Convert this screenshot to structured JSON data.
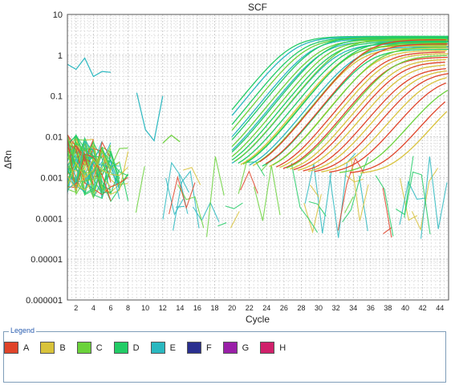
{
  "chart_data": {
    "type": "line",
    "title": "SCF",
    "xlabel": "Cycle",
    "ylabel": "ΔRn",
    "y_scale": "log",
    "xlim": [
      1,
      45
    ],
    "ylim": [
      1e-06,
      10
    ],
    "x_ticks": [
      "2",
      "4",
      "6",
      "8",
      "10",
      "12",
      "14",
      "16",
      "18",
      "20",
      "22",
      "24",
      "26",
      "28",
      "30",
      "32",
      "34",
      "36",
      "38",
      "40",
      "42",
      "44"
    ],
    "y_ticks": [
      "10",
      "1",
      "0.1",
      "0.01",
      "0.001",
      "0.0001",
      "0.00001",
      "0.000001"
    ],
    "grid": true,
    "legend": {
      "title": "Legend",
      "placement": "bottom",
      "items": [
        {
          "label": "A",
          "color": "#e0442a"
        },
        {
          "label": "B",
          "color": "#d8c23a"
        },
        {
          "label": "C",
          "color": "#6ad23a"
        },
        {
          "label": "D",
          "color": "#22cc66"
        },
        {
          "label": "E",
          "color": "#2ab8c0"
        },
        {
          "label": "F",
          "color": "#2a2f8f"
        },
        {
          "label": "G",
          "color": "#9a1fa8"
        },
        {
          "label": "H",
          "color": "#d0206a"
        }
      ]
    },
    "amplification_curves": [
      {
        "group": "D",
        "ct": 20.5,
        "plateau": 2.9
      },
      {
        "group": "E",
        "ct": 21.0,
        "plateau": 2.8
      },
      {
        "group": "D",
        "ct": 21.8,
        "plateau": 2.7
      },
      {
        "group": "C",
        "ct": 22.3,
        "plateau": 2.6
      },
      {
        "group": "E",
        "ct": 22.9,
        "plateau": 2.5
      },
      {
        "group": "D",
        "ct": 23.4,
        "plateau": 2.8
      },
      {
        "group": "C",
        "ct": 23.9,
        "plateau": 2.4
      },
      {
        "group": "E",
        "ct": 24.2,
        "plateau": 2.2
      },
      {
        "group": "D",
        "ct": 24.7,
        "plateau": 2.6
      },
      {
        "group": "C",
        "ct": 25.1,
        "plateau": 2.3
      },
      {
        "group": "D",
        "ct": 25.5,
        "plateau": 2.1
      },
      {
        "group": "E",
        "ct": 25.9,
        "plateau": 1.9
      },
      {
        "group": "C",
        "ct": 26.3,
        "plateau": 2.5
      },
      {
        "group": "D",
        "ct": 26.7,
        "plateau": 2.0
      },
      {
        "group": "B",
        "ct": 27.0,
        "plateau": 1.7
      },
      {
        "group": "C",
        "ct": 27.3,
        "plateau": 1.8
      },
      {
        "group": "D",
        "ct": 27.7,
        "plateau": 2.2
      },
      {
        "group": "E",
        "ct": 28.0,
        "plateau": 1.6
      },
      {
        "group": "B",
        "ct": 28.4,
        "plateau": 1.5
      },
      {
        "group": "C",
        "ct": 28.8,
        "plateau": 2.0
      },
      {
        "group": "A",
        "ct": 29.2,
        "plateau": 2.4
      },
      {
        "group": "D",
        "ct": 29.5,
        "plateau": 1.4
      },
      {
        "group": "A",
        "ct": 29.9,
        "plateau": 1.9
      },
      {
        "group": "B",
        "ct": 30.3,
        "plateau": 1.3
      },
      {
        "group": "C",
        "ct": 30.7,
        "plateau": 1.6
      },
      {
        "group": "A",
        "ct": 31.1,
        "plateau": 1.2
      },
      {
        "group": "B",
        "ct": 31.5,
        "plateau": 1.1
      },
      {
        "group": "A",
        "ct": 31.9,
        "plateau": 0.9
      },
      {
        "group": "C",
        "ct": 32.3,
        "plateau": 1.0
      },
      {
        "group": "B",
        "ct": 32.7,
        "plateau": 0.8
      },
      {
        "group": "A",
        "ct": 33.1,
        "plateau": 0.7
      },
      {
        "group": "B",
        "ct": 33.6,
        "plateau": 0.6
      },
      {
        "group": "A",
        "ct": 34.2,
        "plateau": 0.5
      },
      {
        "group": "B",
        "ct": 34.8,
        "plateau": 0.45
      },
      {
        "group": "A",
        "ct": 35.5,
        "plateau": 0.4
      },
      {
        "group": "B",
        "ct": 36.3,
        "plateau": 0.35
      },
      {
        "group": "A",
        "ct": 37.2,
        "plateau": 0.3
      },
      {
        "group": "C",
        "ct": 38.4,
        "plateau": 0.25
      },
      {
        "group": "A",
        "ct": 39.6,
        "plateau": 0.22
      },
      {
        "group": "B",
        "ct": 40.8,
        "plateau": 0.2
      }
    ],
    "background_noise": {
      "early_band": {
        "x_range": [
          1,
          8
        ],
        "y_range": [
          0.0001,
          0.03
        ]
      },
      "scattered_range": {
        "x_range": [
          8,
          45
        ],
        "y_range": [
          1e-05,
          0.005
        ]
      },
      "outliers": [
        {
          "group": "E",
          "x": [
            1,
            2,
            3,
            4,
            5,
            6
          ],
          "y": [
            0.6,
            0.45,
            0.85,
            0.3,
            0.4,
            0.38
          ]
        },
        {
          "group": "E",
          "x": [
            9,
            10,
            11,
            12
          ],
          "y": [
            0.12,
            0.015,
            0.008,
            0.1
          ]
        },
        {
          "group": "C",
          "x": [
            12,
            13,
            14
          ],
          "y": [
            0.007,
            0.011,
            0.0075
          ]
        }
      ]
    }
  }
}
